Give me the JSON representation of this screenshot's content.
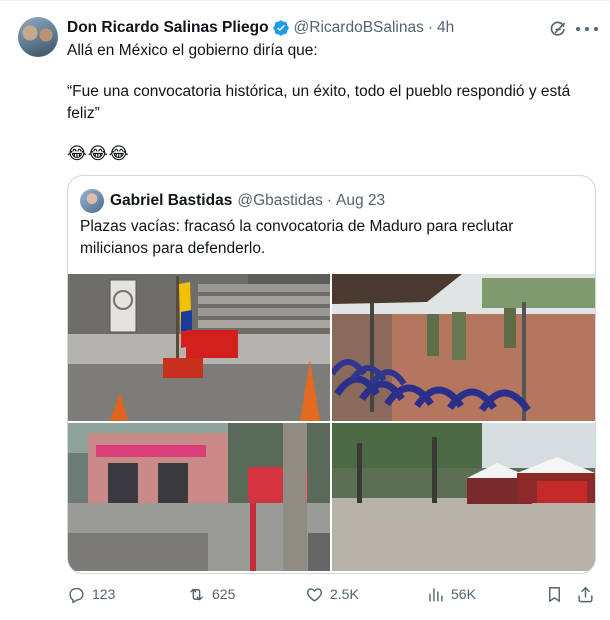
{
  "tweet": {
    "author_name": "Don Ricardo Salinas Pliego",
    "author_handle": "@RicardoBSalinas",
    "separator": "·",
    "time": "4h",
    "line1": "Allá en México el gobierno diría que:",
    "line2": "“Fue una convocatoria histórica, un éxito, todo el pueblo respondió y está feliz”",
    "emojis": "😂😂😂"
  },
  "quote": {
    "author_name": "Gabriel Bastidas",
    "author_handle": "@Gbastidas",
    "separator": "·",
    "date": "Aug 23",
    "text": "Plazas vacías: fracasó la convocatoria de Maduro para reclutar milicianos para defenderlo."
  },
  "actions": {
    "replies": "123",
    "reposts": "625",
    "likes": "2.5K",
    "views": "56K"
  },
  "colors": {
    "verified_blue": "#1d9bf0",
    "secondary_text": "#536471",
    "border": "#cfd9de"
  },
  "icons": [
    "verified-badge-icon",
    "grok-icon",
    "more-icon",
    "reply-icon",
    "repost-icon",
    "like-icon",
    "views-icon",
    "bookmark-icon",
    "share-icon"
  ]
}
